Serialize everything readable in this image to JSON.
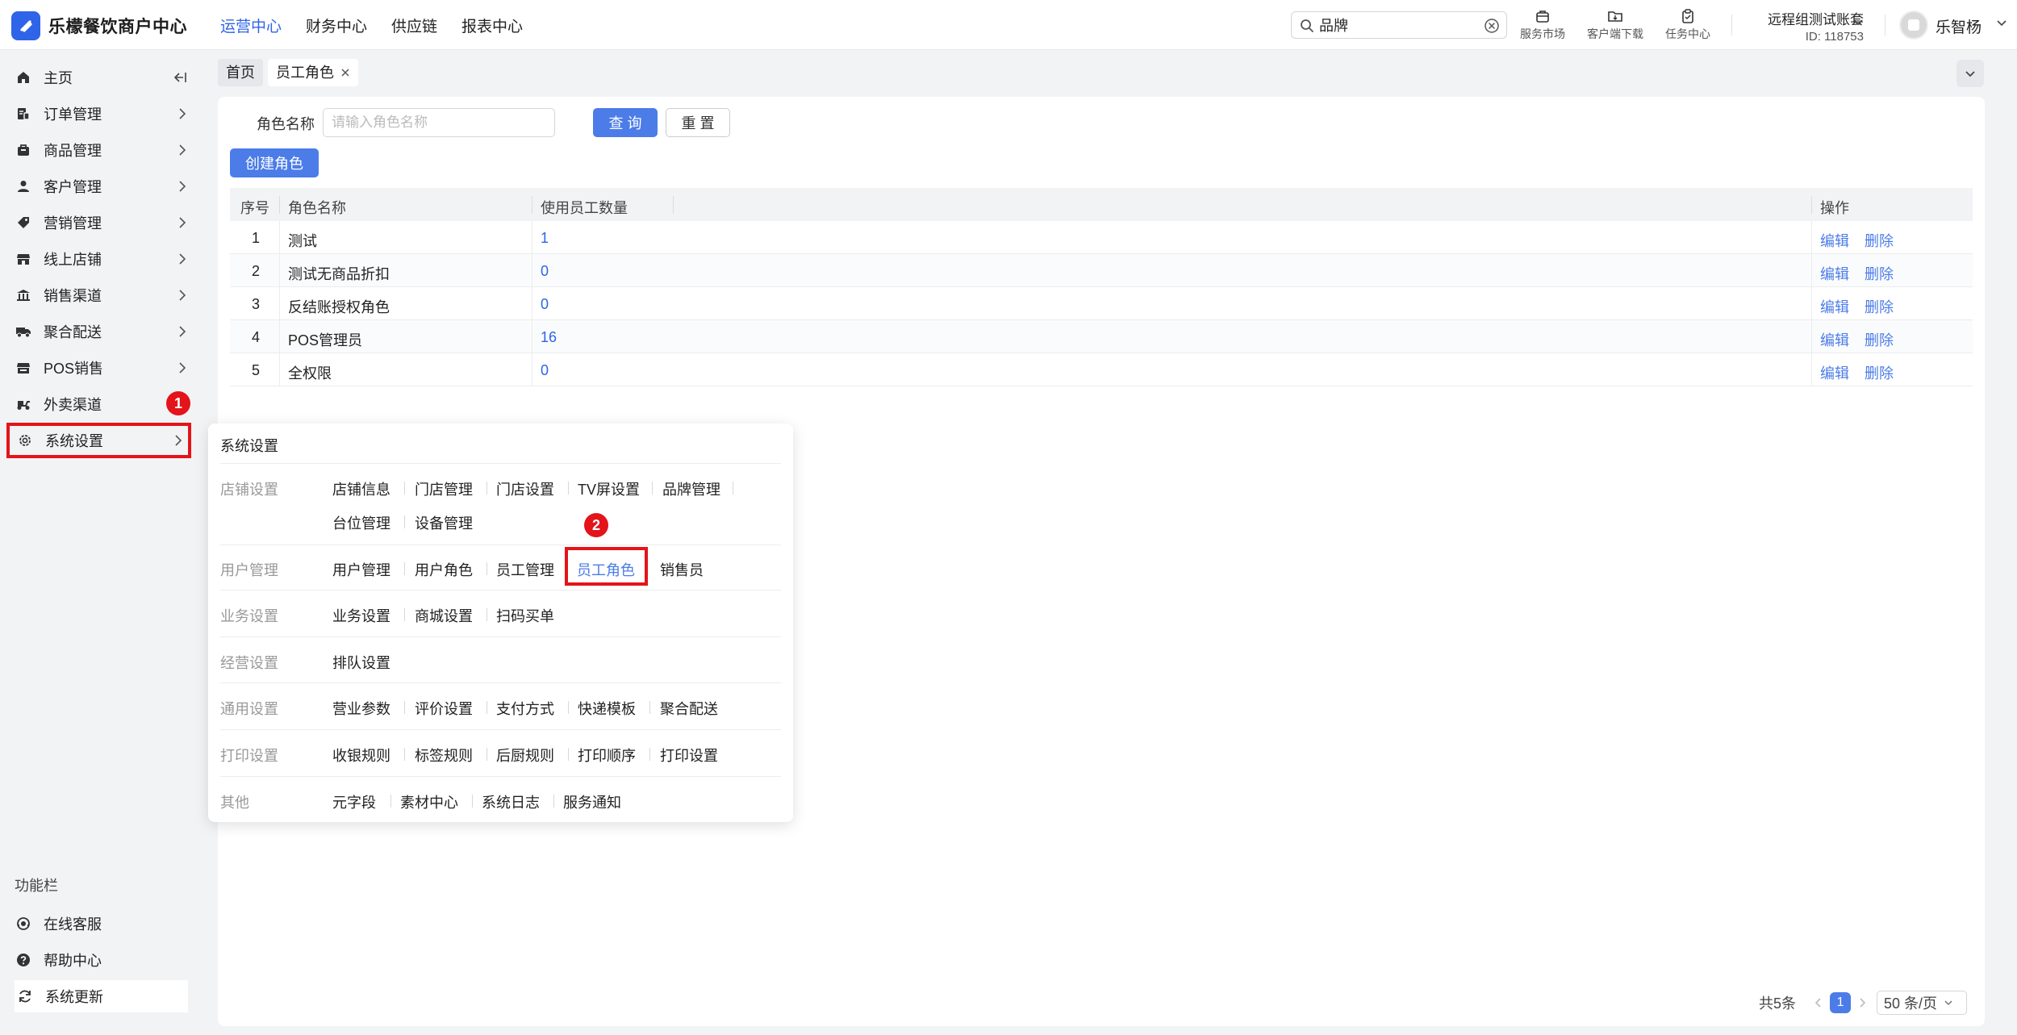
{
  "header": {
    "logo_text": "乐檬餐饮商户中心",
    "nav": [
      {
        "label": "运营中心",
        "active": true
      },
      {
        "label": "财务中心",
        "active": false
      },
      {
        "label": "供应链",
        "active": false
      },
      {
        "label": "报表中心",
        "active": false
      }
    ],
    "search_value": "品牌",
    "tools": [
      "服务市场",
      "客户端下载",
      "任务中心"
    ],
    "account_name": "远程组测试账套",
    "account_id": "ID: 118753",
    "user_name": "乐智杨"
  },
  "sidebar": {
    "items": [
      {
        "label": "主页",
        "icon": "home-icon"
      },
      {
        "label": "订单管理",
        "icon": "order-icon"
      },
      {
        "label": "商品管理",
        "icon": "goods-icon"
      },
      {
        "label": "客户管理",
        "icon": "user-icon"
      },
      {
        "label": "营销管理",
        "icon": "tag-icon"
      },
      {
        "label": "线上店铺",
        "icon": "store-icon"
      },
      {
        "label": "销售渠道",
        "icon": "bank-icon"
      },
      {
        "label": "聚合配送",
        "icon": "delivery-icon"
      },
      {
        "label": "POS销售",
        "icon": "pos-icon"
      },
      {
        "label": "外卖渠道",
        "icon": "scooter-icon"
      },
      {
        "label": "系统设置",
        "icon": "gear-icon"
      }
    ],
    "func_title": "功能栏",
    "func_items": [
      {
        "label": "在线客服",
        "icon": "headset-icon"
      },
      {
        "label": "帮助中心",
        "icon": "help-icon"
      },
      {
        "label": "系统更新",
        "icon": "refresh-icon"
      }
    ],
    "badge_1": "1"
  },
  "tabs": [
    {
      "label": "首页",
      "active": false
    },
    {
      "label": "员工角色",
      "active": true
    }
  ],
  "filter": {
    "label": "角色名称",
    "placeholder": "请输入角色名称",
    "query_label": "查 询",
    "reset_label": "重 置",
    "create_label": "创建角色"
  },
  "table": {
    "columns": [
      "序号",
      "角色名称",
      "使用员工数量",
      "操作"
    ],
    "rows": [
      {
        "no": "1",
        "name": "测试",
        "count": "1"
      },
      {
        "no": "2",
        "name": "测试无商品折扣",
        "count": "0"
      },
      {
        "no": "3",
        "name": "反结账授权角色",
        "count": "0"
      },
      {
        "no": "4",
        "name": "POS管理员",
        "count": "16"
      },
      {
        "no": "5",
        "name": "全权限",
        "count": "0"
      }
    ],
    "edit_label": "编辑",
    "delete_label": "删除"
  },
  "pager": {
    "total": "共5条",
    "current": "1",
    "size": "50 条/页"
  },
  "panel": {
    "title": "系统设置",
    "badge_2": "2",
    "groups": [
      {
        "name": "店铺设置",
        "links": [
          "店铺信息",
          "门店管理",
          "门店设置",
          "TV屏设置",
          "品牌管理",
          "台位管理",
          "设备管理"
        ]
      },
      {
        "name": "用户管理",
        "links": [
          "用户管理",
          "用户角色",
          "员工管理",
          "员工角色",
          "销售员"
        ]
      },
      {
        "name": "业务设置",
        "links": [
          "业务设置",
          "商城设置",
          "扫码买单"
        ]
      },
      {
        "name": "经营设置",
        "links": [
          "排队设置"
        ]
      },
      {
        "name": "通用设置",
        "links": [
          "营业参数",
          "评价设置",
          "支付方式",
          "快递模板",
          "聚合配送"
        ]
      },
      {
        "name": "打印设置",
        "links": [
          "收银规则",
          "标签规则",
          "后厨规则",
          "打印顺序",
          "打印设置"
        ]
      },
      {
        "name": "其他",
        "links": [
          "元字段",
          "素材中心",
          "系统日志",
          "服务通知"
        ]
      }
    ]
  },
  "colors": {
    "accent": "#2f63e8",
    "button": "#4c7ce8",
    "highlight": "#e3141a"
  }
}
